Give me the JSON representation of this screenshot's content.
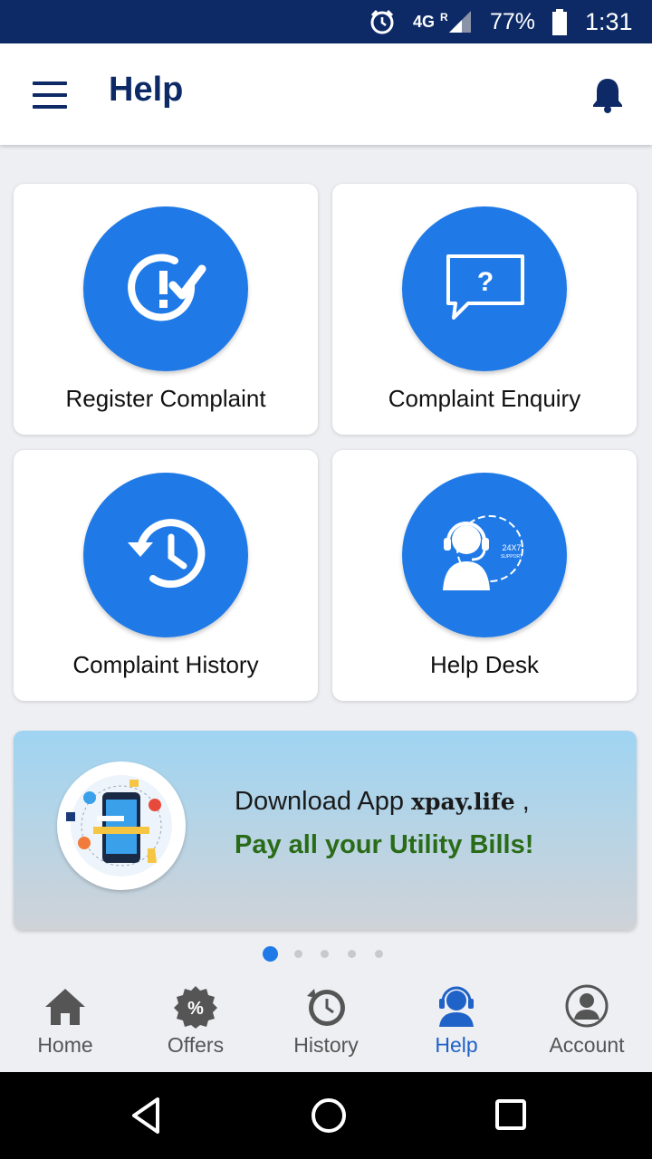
{
  "status_bar": {
    "network": "4G",
    "roaming": "R",
    "battery": "77%",
    "time": "1:31",
    "icons": [
      "alarm-icon",
      "signal-icon",
      "battery-icon"
    ]
  },
  "header": {
    "title": "Help",
    "icons": [
      "menu-icon",
      "bell-icon"
    ]
  },
  "cards": [
    {
      "label": "Register Complaint",
      "icon": "complaint-check-icon"
    },
    {
      "label": "Complaint Enquiry",
      "icon": "question-chat-icon"
    },
    {
      "label": "Complaint History",
      "icon": "history-clock-icon"
    },
    {
      "label": "Help Desk",
      "icon": "support-headset-icon"
    }
  ],
  "banner": {
    "line1_prefix": "Download App ",
    "brand": "xpay.life",
    "line1_suffix": " ,",
    "line2": "Pay all your Utility Bills!",
    "illustration": "phone-bills-illustration"
  },
  "carousel": {
    "total": 5,
    "active_index": 0
  },
  "bottom_nav": {
    "active": "Help",
    "items": [
      {
        "label": "Home",
        "icon": "home-icon"
      },
      {
        "label": "Offers",
        "icon": "percent-badge-icon"
      },
      {
        "label": "History",
        "icon": "history-icon"
      },
      {
        "label": "Help",
        "icon": "help-headset-icon"
      },
      {
        "label": "Account",
        "icon": "account-icon"
      }
    ]
  },
  "system_nav": [
    "back-icon",
    "home-circle-icon",
    "recents-icon"
  ],
  "colors": {
    "status_bar": "#0d2a66",
    "primary_blue": "#1f7ae8",
    "title_navy": "#0d2a66",
    "active_nav": "#1f62c8",
    "banner_green": "#2a6b18",
    "background": "#eeeff3"
  }
}
